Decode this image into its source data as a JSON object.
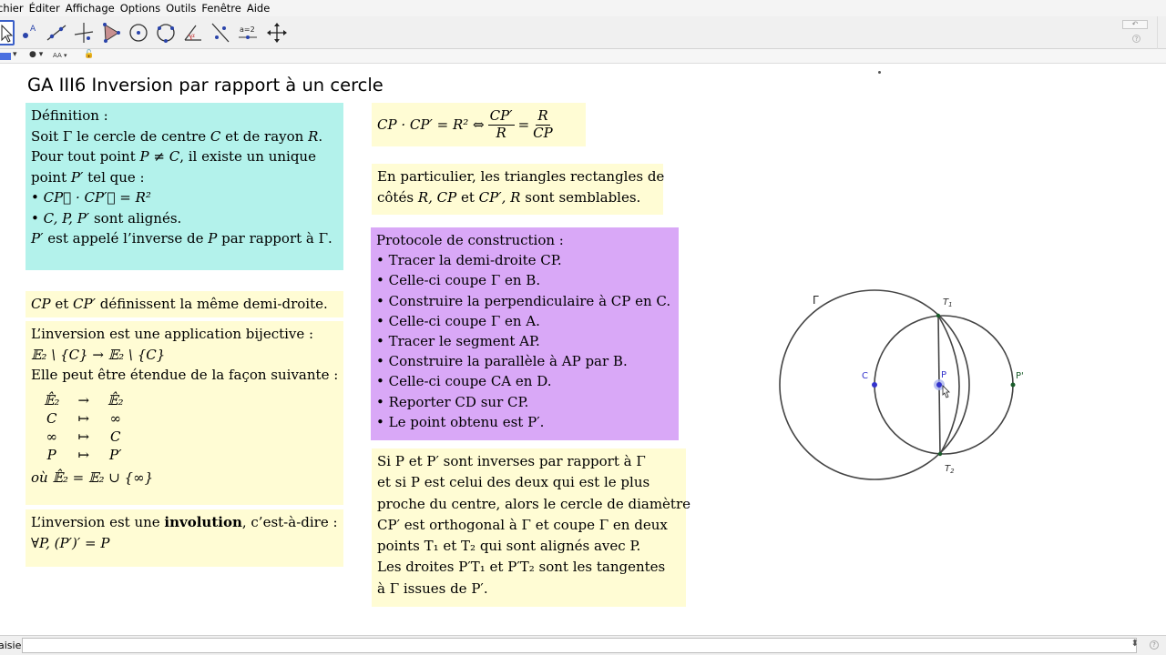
{
  "menu": [
    "chier",
    "Éditer",
    "Affichage",
    "Options",
    "Outils",
    "Fenêtre",
    "Aide"
  ],
  "toolbar": {
    "tools": [
      {
        "name": "move-tool",
        "icon": "arrow-cursor-icon"
      },
      {
        "name": "point-tool",
        "icon": "point-a-icon"
      },
      {
        "name": "line-tool",
        "icon": "line-icon"
      },
      {
        "name": "perpendicular-tool",
        "icon": "perpendicular-icon"
      },
      {
        "name": "polygon-tool",
        "icon": "polygon-icon"
      },
      {
        "name": "circle-tool",
        "icon": "circle-center-icon"
      },
      {
        "name": "circle-3pt-tool",
        "icon": "circle-points-icon"
      },
      {
        "name": "angle-tool",
        "icon": "angle-icon"
      },
      {
        "name": "reflect-tool",
        "icon": "reflect-icon"
      },
      {
        "name": "slider-tool",
        "icon": "slider-icon",
        "label": "a=2"
      },
      {
        "name": "move-view-tool",
        "icon": "move-cross-icon"
      }
    ]
  },
  "stylebar": {
    "text_size": "AA"
  },
  "title": "GA III6 Inversion par rapport à un cercle",
  "definition": {
    "heading": "Définition :",
    "l1_a": "Soit ",
    "l1_gamma": "Γ",
    "l1_b": " le cercle de centre ",
    "l1_c": "C",
    "l1_d": " et de rayon ",
    "l1_r": "R",
    "l1_e": ".",
    "l2_a": "Pour tout point ",
    "l2_math": "P ≠ C",
    "l2_b": ", il existe un unique",
    "l3_a": "point ",
    "l3_math": "P′",
    "l3_b": " tel que :",
    "bullet1": "• CP⃗ · CP′⃗ = R²",
    "bullet2_math": "C, P, P′",
    "bullet2_text": " sont alignés.",
    "l6_math": "P′",
    "l6_a": " est appelé l’inverse de ",
    "l6_p": "P",
    "l6_b": " par rapport à ",
    "l6_gamma": "Γ",
    "l6_c": "."
  },
  "demi": {
    "math1": "CP",
    "a": " et ",
    "math2": "CP′",
    "b": " définissent la même demi-droite."
  },
  "bij": {
    "l1": "L’inversion est une application bijective :",
    "l2": "𝔼₂ \\ {C} → 𝔼₂ \\ {C}",
    "l3": "Elle peut être étendue de la façon suivante :",
    "rows": [
      [
        "𝔼̂₂",
        "→",
        "𝔼̂₂"
      ],
      [
        "C",
        "↦",
        "∞"
      ],
      [
        "∞",
        "↦",
        "C"
      ],
      [
        "P",
        "↦",
        "P′"
      ]
    ],
    "last": "où 𝔼̂₂ = 𝔼₂ ∪ {∞}"
  },
  "invol": {
    "a": "L’inversion est une ",
    "bold": "involution",
    "b": ", c’est-à-dire :",
    "l2": "∀P, (P′)′ = P"
  },
  "formula": {
    "text": "CP · CP′ = R² ⇔ CP′/R = R/CP",
    "lhs": "CP · CP′ = R² ⇔",
    "f1n": "CP′",
    "f1d": "R",
    "eq": "=",
    "f2n": "R",
    "f2d": "CP"
  },
  "particulier": {
    "l1": "En particulier, les triangles rectangles de",
    "l2_a": "côtés ",
    "l2_math": "R, CP",
    "l2_b": " et ",
    "l2_math2": "CP′, R",
    "l2_c": " sont semblables."
  },
  "protocole": {
    "heading": "Protocole de construction :",
    "steps": [
      "• Tracer la demi-droite CP.",
      "• Celle-ci coupe Γ en B.",
      "• Construire la perpendiculaire à CP en C.",
      "• Celle-ci coupe Γ en A.",
      "• Tracer le segment AP.",
      "• Construire la parallèle à AP par B.",
      "• Celle-ci coupe CA en D.",
      "• Reporter CD sur CP.",
      "• Le point obtenu est P′."
    ]
  },
  "si": {
    "lines": [
      "Si P et P′ sont inverses par rapport à Γ",
      "et si P est celui des deux qui est le plus",
      "proche du centre, alors le cercle de diamètre",
      "CP′ est orthogonal à Γ et coupe Γ en deux",
      "points T₁ et T₂ qui sont alignés avec P.",
      "Les droites P′T₁ et P′T₂ sont les tangentes",
      "à Γ issues de P′."
    ]
  },
  "figure": {
    "labels": {
      "gamma": "Γ",
      "c": "C",
      "p": "P",
      "pprime": "P'",
      "t1": "T",
      "t1_sub": "1",
      "t2": "T",
      "t2_sub": "2"
    },
    "colors": {
      "point_blue": "#3333cc",
      "point_green": "#1a5c2a",
      "stroke": "#444444"
    }
  },
  "inputbar": {
    "label": "aisie:",
    "value": ""
  }
}
